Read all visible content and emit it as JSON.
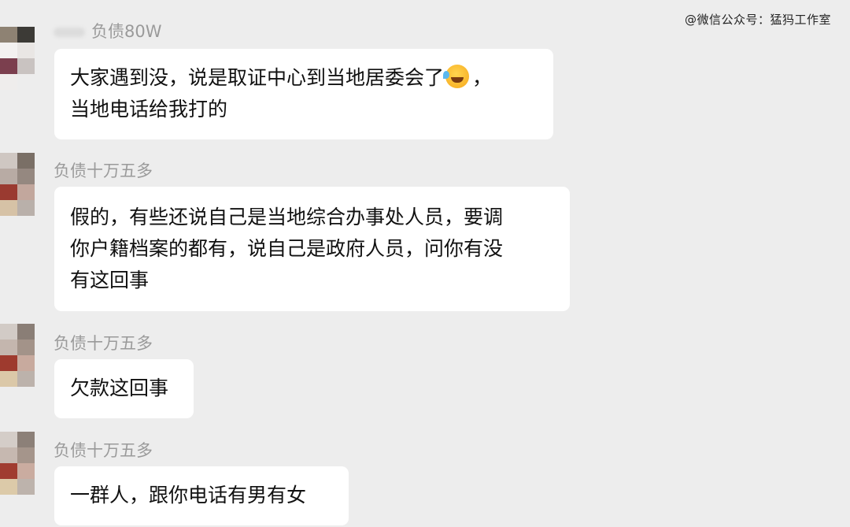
{
  "watermark": "@微信公众号：猛犸工作室",
  "emoji_icon": "laughing-crying-emoji",
  "messages": [
    {
      "sender": "负债80W",
      "lines": [
        "大家遇到没，说是取证中心到当地居委会了",
        "，",
        "当地电话给我打的"
      ]
    },
    {
      "sender": "负债十万五多",
      "lines": [
        "假的，有些还说自己是当地综合办事处人员，要调",
        "你户籍档案的都有，说自己是政府人员，问你有没",
        "有这回事"
      ]
    },
    {
      "sender": "负债十万五多",
      "lines": [
        "欠款这回事"
      ]
    },
    {
      "sender": "负债十万五多",
      "lines": [
        "一群人，跟你电话有男有女"
      ]
    }
  ],
  "colors": {
    "background": "#ededed",
    "bubble": "#ffffff",
    "sender_text": "#9a9a9a",
    "message_text": "#111111"
  }
}
